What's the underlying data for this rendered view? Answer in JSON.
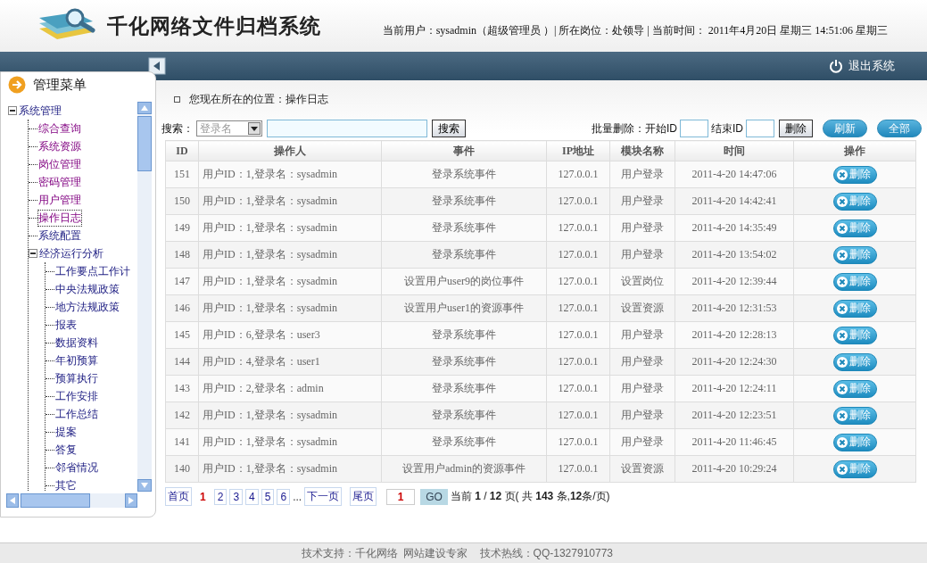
{
  "header": {
    "title": "千化网络文件归档系统",
    "user_info": "当前用户：sysadmin（超级管理员 ）| 所在岗位：处领导 | 当前时间： 2011年4月20日 星期三 14:51:06 星期三"
  },
  "toolbar": {
    "logout": "退出系统"
  },
  "sidebar": {
    "title": "管理菜单",
    "tree": [
      {
        "label": "系统管理",
        "expanded": true,
        "visited": false,
        "selected": false,
        "children": [
          {
            "label": "综合查询",
            "visited": true,
            "selected": false
          },
          {
            "label": "系统资源",
            "visited": true,
            "selected": false
          },
          {
            "label": "岗位管理",
            "visited": true,
            "selected": false
          },
          {
            "label": "密码管理",
            "visited": true,
            "selected": false
          },
          {
            "label": "用户管理",
            "visited": true,
            "selected": false
          },
          {
            "label": "操作日志",
            "visited": true,
            "selected": true
          },
          {
            "label": "系统配置",
            "visited": false,
            "selected": false
          },
          {
            "label": "经济运行分析",
            "expanded": true,
            "visited": false,
            "selected": false,
            "children": [
              {
                "label": "工作要点工作计",
                "visited": false,
                "selected": false
              },
              {
                "label": "中央法规政策",
                "visited": false,
                "selected": false
              },
              {
                "label": "地方法规政策",
                "visited": false,
                "selected": false
              },
              {
                "label": "报表",
                "visited": false,
                "selected": false
              },
              {
                "label": "数据资料",
                "visited": false,
                "selected": false
              },
              {
                "label": "年初预算",
                "visited": false,
                "selected": false
              },
              {
                "label": "预算执行",
                "visited": false,
                "selected": false
              },
              {
                "label": "工作安排",
                "visited": false,
                "selected": false
              },
              {
                "label": "工作总结",
                "visited": false,
                "selected": false
              },
              {
                "label": "提案",
                "visited": false,
                "selected": false
              },
              {
                "label": "答复",
                "visited": false,
                "selected": false
              },
              {
                "label": "邻省情况",
                "visited": false,
                "selected": false
              },
              {
                "label": "其它",
                "visited": false,
                "selected": false
              }
            ]
          }
        ]
      }
    ]
  },
  "breadcrumb": "您现在所在的位置：操作日志",
  "search": {
    "label": "搜索：",
    "select_value": "登录名",
    "button": "搜索"
  },
  "batch_delete": {
    "label": "批量删除：开始ID",
    "end_label": "结束ID",
    "button": "删除"
  },
  "actions": [
    "刷新",
    "全部"
  ],
  "table": {
    "columns": [
      "ID",
      "操作人",
      "事件",
      "IP地址",
      "模块名称",
      "时间",
      "操作"
    ],
    "rows": [
      {
        "id": "151",
        "operator": "用户ID：1,登录名：sysadmin",
        "event": "登录系统事件",
        "ip": "127.0.0.1",
        "module": "用户登录",
        "time": "2011-4-20 14:47:06",
        "action": "删除"
      },
      {
        "id": "150",
        "operator": "用户ID：1,登录名：sysadmin",
        "event": "登录系统事件",
        "ip": "127.0.0.1",
        "module": "用户登录",
        "time": "2011-4-20 14:42:41",
        "action": "删除"
      },
      {
        "id": "149",
        "operator": "用户ID：1,登录名：sysadmin",
        "event": "登录系统事件",
        "ip": "127.0.0.1",
        "module": "用户登录",
        "time": "2011-4-20 14:35:49",
        "action": "删除"
      },
      {
        "id": "148",
        "operator": "用户ID：1,登录名：sysadmin",
        "event": "登录系统事件",
        "ip": "127.0.0.1",
        "module": "用户登录",
        "time": "2011-4-20 13:54:02",
        "action": "删除"
      },
      {
        "id": "147",
        "operator": "用户ID：1,登录名：sysadmin",
        "event": "设置用户user9的岗位事件",
        "ip": "127.0.0.1",
        "module": "设置岗位",
        "time": "2011-4-20 12:39:44",
        "action": "删除"
      },
      {
        "id": "146",
        "operator": "用户ID：1,登录名：sysadmin",
        "event": "设置用户user1的资源事件",
        "ip": "127.0.0.1",
        "module": "设置资源",
        "time": "2011-4-20 12:31:53",
        "action": "删除"
      },
      {
        "id": "145",
        "operator": "用户ID：6,登录名：user3",
        "event": "登录系统事件",
        "ip": "127.0.0.1",
        "module": "用户登录",
        "time": "2011-4-20 12:28:13",
        "action": "删除"
      },
      {
        "id": "144",
        "operator": "用户ID：4,登录名：user1",
        "event": "登录系统事件",
        "ip": "127.0.0.1",
        "module": "用户登录",
        "time": "2011-4-20 12:24:30",
        "action": "删除"
      },
      {
        "id": "143",
        "operator": "用户ID：2,登录名：admin",
        "event": "登录系统事件",
        "ip": "127.0.0.1",
        "module": "用户登录",
        "time": "2011-4-20 12:24:11",
        "action": "删除"
      },
      {
        "id": "142",
        "operator": "用户ID：1,登录名：sysadmin",
        "event": "登录系统事件",
        "ip": "127.0.0.1",
        "module": "用户登录",
        "time": "2011-4-20 12:23:51",
        "action": "删除"
      },
      {
        "id": "141",
        "operator": "用户ID：1,登录名：sysadmin",
        "event": "登录系统事件",
        "ip": "127.0.0.1",
        "module": "用户登录",
        "time": "2011-4-20 11:46:45",
        "action": "删除"
      },
      {
        "id": "140",
        "operator": "用户ID：1,登录名：sysadmin",
        "event": "设置用户admin的资源事件",
        "ip": "127.0.0.1",
        "module": "设置资源",
        "time": "2011-4-20 10:29:24",
        "action": "删除"
      }
    ]
  },
  "pagination": {
    "first": "首页",
    "pages": [
      {
        "label": "1",
        "selected": true
      },
      {
        "label": "2",
        "selected": false
      },
      {
        "label": "3",
        "selected": false
      },
      {
        "label": "4",
        "selected": false
      },
      {
        "label": "5",
        "selected": false
      },
      {
        "label": "6",
        "selected": false
      }
    ],
    "ellipsis": "...",
    "next": "下一页",
    "last": "尾页",
    "page_input": "1",
    "go": "GO",
    "summary": "当前 **1** / **12** 页( 共 **143** 条,**12**条/页)"
  },
  "footer": "技术支持：千化网络  网站建设专家    技术热线：QQ-1327910773"
}
